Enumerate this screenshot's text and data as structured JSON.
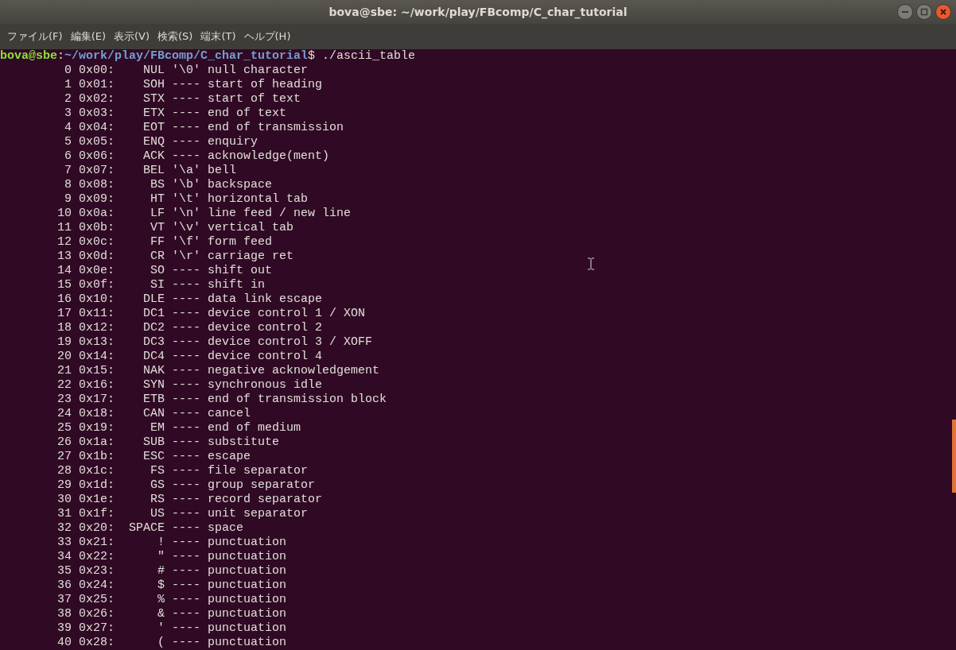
{
  "window": {
    "title": "bova@sbe: ~/work/play/FBcomp/C_char_tutorial"
  },
  "menu": [
    "ファイル(F)",
    "編集(E)",
    "表示(V)",
    "検索(S)",
    "端末(T)",
    "ヘルプ(H)"
  ],
  "prompt": [
    {
      "kind": "user",
      "text": "bova@sbe"
    },
    {
      "kind": "plain",
      "text": ":"
    },
    {
      "kind": "path",
      "text": "~/work/play/FBcomp/C_char_tutorial"
    },
    {
      "kind": "plain",
      "text": "$ ./ascii_table"
    }
  ],
  "rows": [
    {
      "dec": "0",
      "hex": "0x00:",
      "name": "NUL",
      "escape": "'\\0'",
      "description": "null character"
    },
    {
      "dec": "1",
      "hex": "0x01:",
      "name": "SOH",
      "escape": "----",
      "description": "start of heading"
    },
    {
      "dec": "2",
      "hex": "0x02:",
      "name": "STX",
      "escape": "----",
      "description": "start of text"
    },
    {
      "dec": "3",
      "hex": "0x03:",
      "name": "ETX",
      "escape": "----",
      "description": "end of text"
    },
    {
      "dec": "4",
      "hex": "0x04:",
      "name": "EOT",
      "escape": "----",
      "description": "end of transmission"
    },
    {
      "dec": "5",
      "hex": "0x05:",
      "name": "ENQ",
      "escape": "----",
      "description": "enquiry"
    },
    {
      "dec": "6",
      "hex": "0x06:",
      "name": "ACK",
      "escape": "----",
      "description": "acknowledge(ment)"
    },
    {
      "dec": "7",
      "hex": "0x07:",
      "name": "BEL",
      "escape": "'\\a'",
      "description": "bell"
    },
    {
      "dec": "8",
      "hex": "0x08:",
      "name": "BS",
      "escape": "'\\b'",
      "description": "backspace"
    },
    {
      "dec": "9",
      "hex": "0x09:",
      "name": "HT",
      "escape": "'\\t'",
      "description": "horizontal tab"
    },
    {
      "dec": "10",
      "hex": "0x0a:",
      "name": "LF",
      "escape": "'\\n'",
      "description": "line feed / new line"
    },
    {
      "dec": "11",
      "hex": "0x0b:",
      "name": "VT",
      "escape": "'\\v'",
      "description": "vertical tab"
    },
    {
      "dec": "12",
      "hex": "0x0c:",
      "name": "FF",
      "escape": "'\\f'",
      "description": "form feed"
    },
    {
      "dec": "13",
      "hex": "0x0d:",
      "name": "CR",
      "escape": "'\\r'",
      "description": "carriage ret"
    },
    {
      "dec": "14",
      "hex": "0x0e:",
      "name": "SO",
      "escape": "----",
      "description": "shift out"
    },
    {
      "dec": "15",
      "hex": "0x0f:",
      "name": "SI",
      "escape": "----",
      "description": "shift in"
    },
    {
      "dec": "16",
      "hex": "0x10:",
      "name": "DLE",
      "escape": "----",
      "description": "data link escape"
    },
    {
      "dec": "17",
      "hex": "0x11:",
      "name": "DC1",
      "escape": "----",
      "description": "device control 1 / XON"
    },
    {
      "dec": "18",
      "hex": "0x12:",
      "name": "DC2",
      "escape": "----",
      "description": "device control 2"
    },
    {
      "dec": "19",
      "hex": "0x13:",
      "name": "DC3",
      "escape": "----",
      "description": "device control 3 / XOFF"
    },
    {
      "dec": "20",
      "hex": "0x14:",
      "name": "DC4",
      "escape": "----",
      "description": "device control 4"
    },
    {
      "dec": "21",
      "hex": "0x15:",
      "name": "NAK",
      "escape": "----",
      "description": "negative acknowledgement"
    },
    {
      "dec": "22",
      "hex": "0x16:",
      "name": "SYN",
      "escape": "----",
      "description": "synchronous idle"
    },
    {
      "dec": "23",
      "hex": "0x17:",
      "name": "ETB",
      "escape": "----",
      "description": "end of transmission block"
    },
    {
      "dec": "24",
      "hex": "0x18:",
      "name": "CAN",
      "escape": "----",
      "description": "cancel"
    },
    {
      "dec": "25",
      "hex": "0x19:",
      "name": "EM",
      "escape": "----",
      "description": "end of medium"
    },
    {
      "dec": "26",
      "hex": "0x1a:",
      "name": "SUB",
      "escape": "----",
      "description": "substitute"
    },
    {
      "dec": "27",
      "hex": "0x1b:",
      "name": "ESC",
      "escape": "----",
      "description": "escape"
    },
    {
      "dec": "28",
      "hex": "0x1c:",
      "name": "FS",
      "escape": "----",
      "description": "file separator"
    },
    {
      "dec": "29",
      "hex": "0x1d:",
      "name": "GS",
      "escape": "----",
      "description": "group separator"
    },
    {
      "dec": "30",
      "hex": "0x1e:",
      "name": "RS",
      "escape": "----",
      "description": "record separator"
    },
    {
      "dec": "31",
      "hex": "0x1f:",
      "name": "US",
      "escape": "----",
      "description": "unit separator"
    },
    {
      "dec": "32",
      "hex": "0x20:",
      "name": "SPACE",
      "escape": "----",
      "description": "space"
    },
    {
      "dec": "33",
      "hex": "0x21:",
      "name": "!",
      "escape": "----",
      "description": "punctuation"
    },
    {
      "dec": "34",
      "hex": "0x22:",
      "name": "\"",
      "escape": "----",
      "description": "punctuation"
    },
    {
      "dec": "35",
      "hex": "0x23:",
      "name": "#",
      "escape": "----",
      "description": "punctuation"
    },
    {
      "dec": "36",
      "hex": "0x24:",
      "name": "$",
      "escape": "----",
      "description": "punctuation"
    },
    {
      "dec": "37",
      "hex": "0x25:",
      "name": "%",
      "escape": "----",
      "description": "punctuation"
    },
    {
      "dec": "38",
      "hex": "0x26:",
      "name": "&",
      "escape": "----",
      "description": "punctuation"
    },
    {
      "dec": "39",
      "hex": "0x27:",
      "name": "'",
      "escape": "----",
      "description": "punctuation"
    },
    {
      "dec": "40",
      "hex": "0x28:",
      "name": "(",
      "escape": "----",
      "description": "punctuation"
    }
  ]
}
